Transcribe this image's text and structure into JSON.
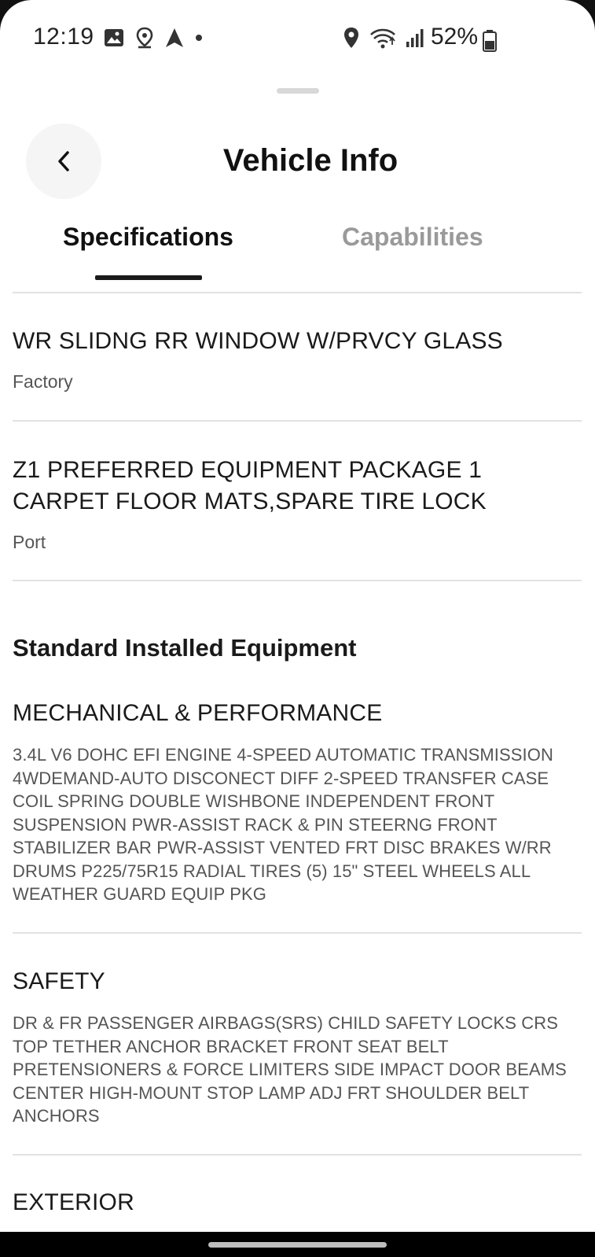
{
  "status_bar": {
    "time": "12:19",
    "battery": "52%",
    "left_icons": [
      "image-icon",
      "location-pin-icon",
      "navigation-arrow-icon",
      "dot-icon"
    ],
    "right_icons": [
      "location-icon",
      "wifi-icon",
      "signal-icon",
      "battery-icon"
    ]
  },
  "header": {
    "title": "Vehicle Info",
    "back_icon": "chevron-left-icon"
  },
  "tabs": [
    {
      "label": "Specifications",
      "active": true
    },
    {
      "label": "Capabilities",
      "active": false
    }
  ],
  "options": [
    {
      "title": "WR SLIDNG RR WINDOW W/PRVCY GLASS",
      "source": "Factory"
    },
    {
      "title": "Z1 PREFERRED EQUIPMENT PACKAGE 1 CARPET FLOOR MATS,SPARE TIRE LOCK",
      "source": "Port"
    }
  ],
  "standard_section": {
    "heading": "Standard Installed Equipment",
    "categories": [
      {
        "title": "MECHANICAL & PERFORMANCE",
        "description": "3.4L V6 DOHC EFI ENGINE 4-SPEED AUTOMATIC TRANSMISSION 4WDEMAND-AUTO DISCONECT DIFF 2-SPEED TRANSFER CASE COIL SPRING DOUBLE WISHBONE INDEPENDENT FRONT SUSPENSION PWR-ASSIST RACK & PIN STEERNG FRONT STABILIZER BAR PWR-ASSIST VENTED FRT DISC BRAKES W/RR DRUMS P225/75R15 RADIAL TIRES (5) 15\" STEEL WHEELS ALL WEATHER GUARD EQUIP PKG"
      },
      {
        "title": "SAFETY",
        "description": "DR & FR PASSENGER AIRBAGS(SRS) CHILD SAFETY LOCKS CRS TOP TETHER ANCHOR BRACKET FRONT SEAT BELT PRETENSIONERS & FORCE LIMITERS SIDE IMPACT DOOR BEAMS CENTER HIGH-MOUNT STOP LAMP ADJ FRT SHOULDER BELT ANCHORS"
      },
      {
        "title": "EXTERIOR",
        "description": ""
      }
    ]
  },
  "colors": {
    "background": "#ffffff",
    "text_primary": "#1a1a1a",
    "text_secondary": "#555555",
    "tab_inactive": "#9a9a9a",
    "divider": "#e2e2e2",
    "back_button_bg": "#f5f5f5"
  }
}
